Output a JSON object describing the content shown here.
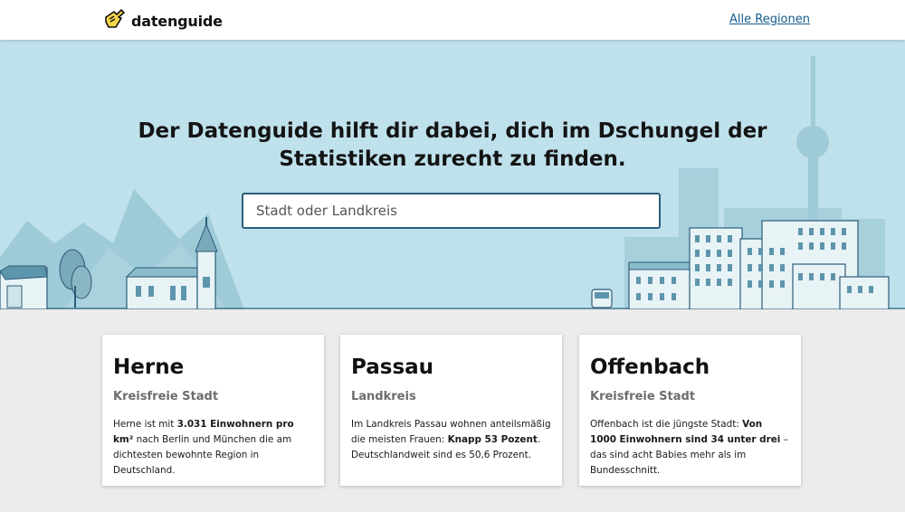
{
  "header": {
    "logo_text": "datenguide",
    "logo_icon": "pointing-hand-icon",
    "nav_link": "Alle Regionen"
  },
  "hero": {
    "headline_line1": "Der Datenguide hilft dir dabei, dich im Dschungel der",
    "headline_line2": "Statistiken zurecht zu finden.",
    "search_placeholder": "Stadt oder Landkreis",
    "search_value": ""
  },
  "cards": [
    {
      "title": "Herne",
      "subtitle": "Kreisfreie Stadt",
      "text_before": "Herne ist mit ",
      "text_bold": "3.031 Einwohnern pro km²",
      "text_after": " nach Berlin und München die am dichtesten bewohnte Region in Deutschland."
    },
    {
      "title": "Passau",
      "subtitle": "Landkreis",
      "text_before": "Im Landkreis Passau wohnen anteilsmäßig die meisten Frauen: ",
      "text_bold": "Knapp 53 Pozent",
      "text_after": ". Deutschlandweit sind es 50,6 Prozent."
    },
    {
      "title": "Offenbach",
      "subtitle": "Kreisfreie Stadt",
      "text_before": "Offenbach ist die jüngste Stadt: ",
      "text_bold": "Von 1000 Einwohnern sind 34 unter drei",
      "text_after": " – das sind acht Babies mehr als im Bundesschnitt."
    }
  ],
  "colors": {
    "hero_sky": "#bfe1ec",
    "link": "#145b8c",
    "search_border": "#2b5d79"
  }
}
